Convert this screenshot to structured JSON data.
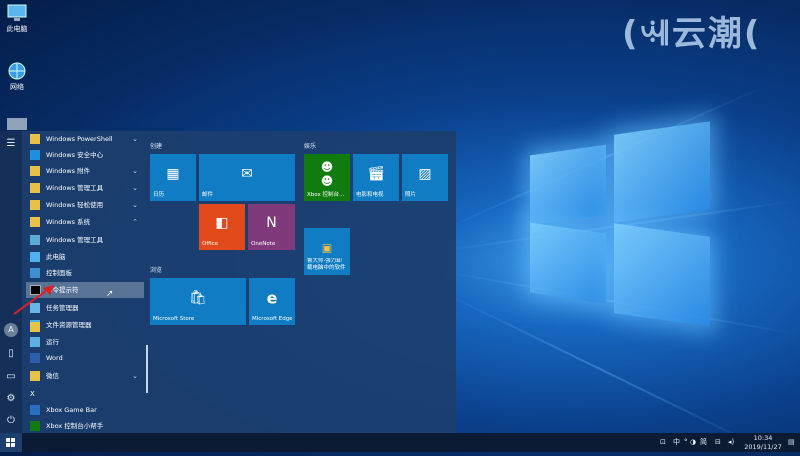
{
  "desktop": {
    "watermark": "(ꕝ云潮(",
    "icons": [
      {
        "label": "此电脑",
        "icon": "computer-icon"
      },
      {
        "label": "网络",
        "icon": "network-icon"
      }
    ]
  },
  "start_menu": {
    "side_icons": [
      "hamburger-icon",
      "user-icon",
      "document-icon",
      "pictures-icon",
      "settings-icon",
      "power-icon"
    ],
    "apps": [
      {
        "label": "Windows PowerShell",
        "icon": "folder-icon",
        "chevron": "⌄"
      },
      {
        "label": "Windows 安全中心",
        "icon": "shield-icon",
        "chevron": ""
      },
      {
        "label": "Windows 附件",
        "icon": "folder-icon",
        "chevron": "⌄"
      },
      {
        "label": "Windows 管理工具",
        "icon": "folder-icon",
        "chevron": "⌄"
      },
      {
        "label": "Windows 轻松使用",
        "icon": "folder-icon",
        "chevron": "⌄"
      },
      {
        "label": "Windows 系统",
        "icon": "folder-icon",
        "chevron": "⌃"
      },
      {
        "label": "Windows 管理工具",
        "icon": "tools-icon",
        "chevron": ""
      },
      {
        "label": "此电脑",
        "icon": "computer-icon",
        "chevron": ""
      },
      {
        "label": "控制面板",
        "icon": "control-panel-icon",
        "chevron": ""
      },
      {
        "label": "命令提示符",
        "icon": "cmd-icon",
        "chevron": ""
      },
      {
        "label": "任务管理器",
        "icon": "task-manager-icon",
        "chevron": ""
      },
      {
        "label": "文件资源管理器",
        "icon": "explorer-icon",
        "chevron": ""
      },
      {
        "label": "运行",
        "icon": "run-icon",
        "chevron": ""
      },
      {
        "label": "Word",
        "icon": "word-icon",
        "chevron": ""
      },
      {
        "label": "微信",
        "icon": "folder-icon",
        "chevron": "⌄"
      }
    ],
    "section_letter": "X",
    "x_apps": [
      {
        "label": "Xbox Game Bar",
        "icon": "xbox-game-bar-icon"
      },
      {
        "label": "Xbox 控制台小帮手",
        "icon": "xbox-icon"
      }
    ],
    "groups": {
      "create": "创建",
      "entertainment": "娱乐",
      "browse": "浏览"
    },
    "tiles": {
      "calendar": "日历",
      "mail": "邮件",
      "office": "Office",
      "onenote": "OneNote",
      "xbox": "Xbox 控制台...",
      "movies": "电影和电视",
      "photos": "照片",
      "master": "鲁大师·强力卸载电脑中的软件",
      "store": "Microsoft Store",
      "edge": "Microsoft Edge"
    }
  },
  "taskbar": {
    "tray_text": "中",
    "tray_mode": "简",
    "time": "10:34",
    "date": "2019/11/27"
  },
  "colors": {
    "accent": "#0f7cc4",
    "office": "#e34a1b",
    "onenote": "#80397b",
    "xbox_green": "#107c10"
  }
}
